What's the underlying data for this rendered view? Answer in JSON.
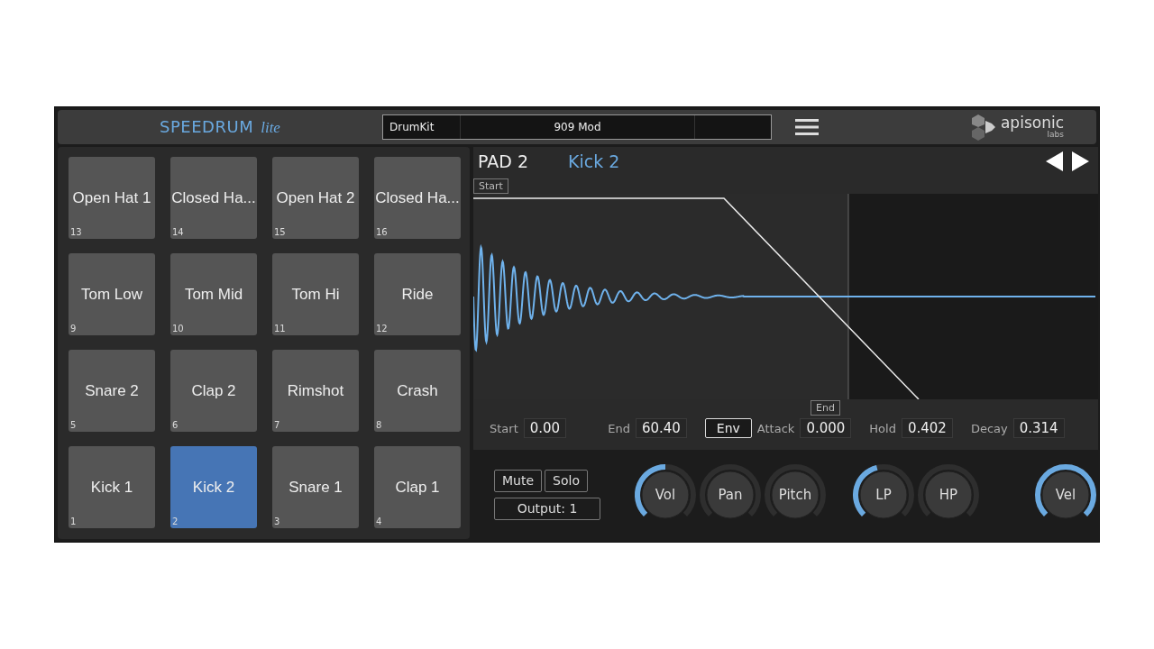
{
  "header": {
    "logo": {
      "name": "SPEEDRUM",
      "edition": "lite"
    },
    "preset": {
      "label": "DrumKit",
      "value": "909 Mod"
    },
    "brand": {
      "name": "apisonic",
      "sub": "labs"
    }
  },
  "pads": [
    {
      "name": "Open Hat 1",
      "number": "13",
      "selected": false
    },
    {
      "name": "Closed Ha...",
      "number": "14",
      "selected": false
    },
    {
      "name": "Open Hat 2",
      "number": "15",
      "selected": false
    },
    {
      "name": "Closed Ha...",
      "number": "16",
      "selected": false
    },
    {
      "name": "Tom Low",
      "number": "9",
      "selected": false
    },
    {
      "name": "Tom Mid",
      "number": "10",
      "selected": false
    },
    {
      "name": "Tom Hi",
      "number": "11",
      "selected": false
    },
    {
      "name": "Ride",
      "number": "12",
      "selected": false
    },
    {
      "name": "Snare 2",
      "number": "5",
      "selected": false
    },
    {
      "name": "Clap 2",
      "number": "6",
      "selected": false
    },
    {
      "name": "Rimshot",
      "number": "7",
      "selected": false
    },
    {
      "name": "Crash",
      "number": "8",
      "selected": false
    },
    {
      "name": "Kick 1",
      "number": "1",
      "selected": false
    },
    {
      "name": "Kick 2",
      "number": "2",
      "selected": true
    },
    {
      "name": "Snare 1",
      "number": "3",
      "selected": false
    },
    {
      "name": "Clap 1",
      "number": "4",
      "selected": false
    }
  ],
  "editor": {
    "pad_label": "PAD 2",
    "sample_name": "Kick 2",
    "start_marker": "Start",
    "end_marker": "End"
  },
  "params": [
    {
      "label": "Start",
      "value": "0.00"
    },
    {
      "label": "End",
      "value": "60.40"
    }
  ],
  "env_button": {
    "label": "Env",
    "selected": true
  },
  "env_params": [
    {
      "label": "Attack",
      "value": "0.000"
    },
    {
      "label": "Hold",
      "value": "0.402"
    },
    {
      "label": "Decay",
      "value": "0.314"
    }
  ],
  "buttons": {
    "mute": {
      "label": "Mute",
      "on": false
    },
    "solo": {
      "label": "Solo",
      "on": false
    },
    "output": "Output: 1"
  },
  "knobs": [
    {
      "label": "Vol"
    },
    {
      "label": "Pan"
    },
    {
      "label": "Pitch"
    },
    {
      "label": "LP"
    },
    {
      "label": "HP"
    },
    {
      "label": "Vel"
    }
  ]
}
